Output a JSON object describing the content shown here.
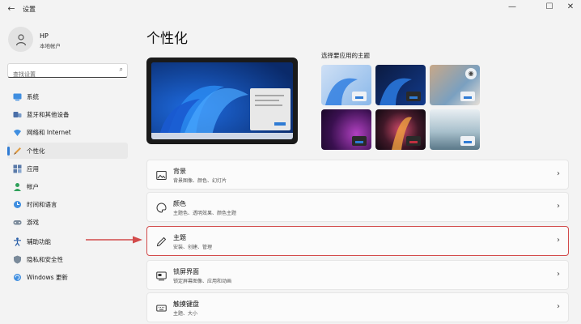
{
  "window": {
    "title": "设置",
    "back_glyph": "←",
    "minimize_glyph": "—",
    "maximize_glyph": "☐",
    "close_glyph": "✕"
  },
  "user": {
    "name": "HP",
    "account_type": "本地帐户"
  },
  "search": {
    "placeholder": "查找设置"
  },
  "sidebar": {
    "items": [
      {
        "label": "系统",
        "icon": "monitor-icon"
      },
      {
        "label": "蓝牙和其他设备",
        "icon": "bluetooth-icon"
      },
      {
        "label": "网络和 Internet",
        "icon": "wifi-icon"
      },
      {
        "label": "个性化",
        "icon": "brush-icon",
        "active": true
      },
      {
        "label": "应用",
        "icon": "apps-icon"
      },
      {
        "label": "帐户",
        "icon": "person-icon"
      },
      {
        "label": "时间和语言",
        "icon": "globe-clock-icon"
      },
      {
        "label": "游戏",
        "icon": "gamepad-icon"
      },
      {
        "label": "辅助功能",
        "icon": "accessibility-icon"
      },
      {
        "label": "隐私和安全性",
        "icon": "shield-icon"
      },
      {
        "label": "Windows 更新",
        "icon": "update-icon"
      }
    ]
  },
  "main": {
    "title": "个性化",
    "themes_label": "选择要应用的主题",
    "cards": [
      {
        "title": "背景",
        "subtitle": "背景图像、颜色、幻灯片",
        "icon": "picture-icon"
      },
      {
        "title": "颜色",
        "subtitle": "主题色、透明效果、颜色主题",
        "icon": "palette-icon"
      },
      {
        "title": "主题",
        "subtitle": "安装、创建、管理",
        "icon": "pen-icon",
        "highlighted": true
      },
      {
        "title": "锁屏界面",
        "subtitle": "锁定屏幕图像、应用和动画",
        "icon": "lockscreen-icon"
      },
      {
        "title": "触摸键盘",
        "subtitle": "主题、大小",
        "icon": "keyboard-icon"
      }
    ],
    "chevron": "›"
  },
  "colors": {
    "accent": "#2f7bd4",
    "highlight_border": "#d24a4a",
    "arrow": "#d24a4a"
  }
}
